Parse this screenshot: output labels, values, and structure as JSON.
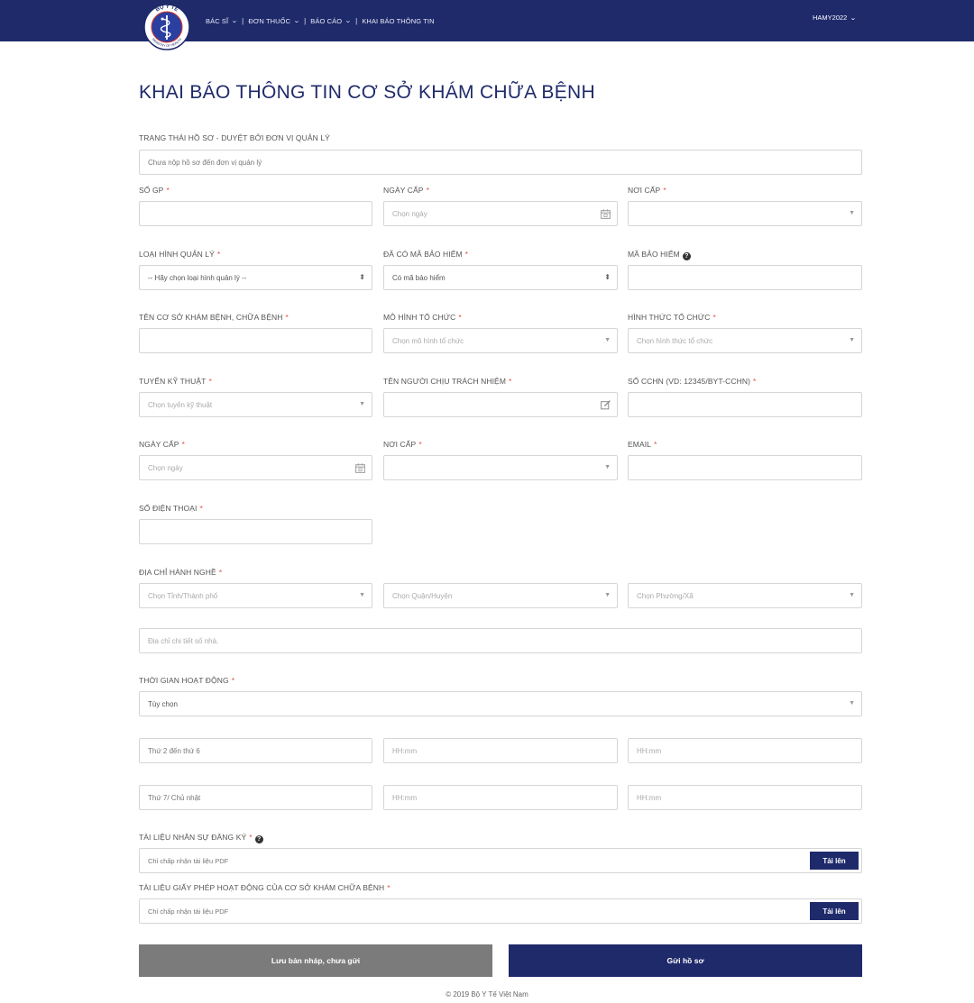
{
  "colors": {
    "brand": "#1f2a6b",
    "draft_button": "#7b7b7b",
    "required": "#e0524f"
  },
  "logo": {
    "top_text": "BỘ Y TẾ",
    "bottom_text": "MINISTRY OF HEALTH"
  },
  "nav": {
    "items": [
      {
        "label": "BÁC SĨ",
        "dropdown": true
      },
      {
        "label": "ĐƠN THUỐC",
        "dropdown": true
      },
      {
        "label": "BÁO CÁO",
        "dropdown": true
      },
      {
        "label": "KHAI BÁO THÔNG TIN",
        "dropdown": false
      }
    ],
    "user": "HAMY2022"
  },
  "page_title": "KHAI BÁO THÔNG TIN CƠ SỞ KHÁM CHỮA BỆNH",
  "form": {
    "status": {
      "label": "TRANG THÁI HỒ SƠ - DUYỆT BỞI ĐƠN VỊ QUẢN LÝ",
      "value": "Chưa nộp hồ sơ đến đơn vị quản lý"
    },
    "so_gp": {
      "label": "SỐ GP",
      "value": ""
    },
    "ngay_cap": {
      "label": "NGÀY CẤP",
      "placeholder": "Chọn ngày"
    },
    "noi_cap": {
      "label": "NƠI CẤP",
      "value": ""
    },
    "loai_hinh": {
      "label": "LOẠI HÌNH QUẢN LÝ",
      "value": "-- Hãy chọn loại hình quản lý --"
    },
    "da_co_ma_bh": {
      "label": "ĐÃ CÓ MÃ BẢO HIỂM",
      "value": "Có mã bảo hiểm"
    },
    "ma_bh": {
      "label": "MÃ BẢO HIỂM",
      "value": ""
    },
    "ten_co_so": {
      "label": "TÊN CƠ SỞ KHÁM BỆNH, CHỮA BỆNH",
      "value": ""
    },
    "mo_hinh": {
      "label": "MÔ HÌNH TỔ CHỨC",
      "placeholder": "Chọn mô hình tổ chức"
    },
    "hinh_thuc": {
      "label": "HÌNH THỨC TỔ CHỨC",
      "placeholder": "Chọn hình thức tổ chức"
    },
    "tuyen_kt": {
      "label": "TUYẾN KỸ THUẬT",
      "placeholder": "Chọn tuyến kỹ thuật"
    },
    "nguoi_chiu_tn": {
      "label": "TÊN NGƯỜI CHỊU TRÁCH NHIỆM",
      "value": ""
    },
    "so_cchn": {
      "label": "SỐ CCHN (VD: 12345/BYT-CCHN)",
      "value": ""
    },
    "ngay_cap2": {
      "label": "NGÀY CẤP",
      "placeholder": "Chọn ngày"
    },
    "noi_cap2": {
      "label": "NƠI CẤP",
      "value": ""
    },
    "email": {
      "label": "EMAIL",
      "value": ""
    },
    "sdt": {
      "label": "SỐ ĐIỆN THOẠI",
      "value": ""
    },
    "dia_chi": {
      "label": "ĐỊA CHỈ HÀNH NGHỀ",
      "tinh_placeholder": "Chọn Tỉnh/Thành phố",
      "quan_placeholder": "Chọn Quận/Huyện",
      "phuong_placeholder": "Chọn Phường/Xã",
      "chi_tiet_placeholder": "Địa chỉ chi tiết số nhà."
    },
    "thoi_gian": {
      "label": "THỜI GIAN HOẠT ĐỘNG",
      "value": "Tùy chọn",
      "rows": [
        {
          "day": "Thứ 2 đến thứ 6",
          "from_placeholder": "HH:mm",
          "to_placeholder": "HH:mm"
        },
        {
          "day": "Thứ 7/ Chủ nhật",
          "from_placeholder": "HH:mm",
          "to_placeholder": "HH:mm"
        }
      ]
    },
    "tai_lieu_ns": {
      "label": "TÀI LIỆU NHÂN SỰ ĐĂNG KÝ",
      "placeholder": "Chỉ chấp nhận tài liệu PDF",
      "button": "Tải lên"
    },
    "tai_lieu_gp": {
      "label": "TÀI LIỆU GIẤY PHÉP HOẠT ĐỘNG CỦA CƠ SỞ KHÁM CHỮA BỆNH",
      "placeholder": "Chỉ chấp nhận tài liệu PDF",
      "button": "Tải lên"
    }
  },
  "buttons": {
    "draft": "Lưu bản nháp, chưa gửi",
    "submit": "Gửi hồ sơ"
  },
  "footer": "© 2019 Bộ Y Tế Việt Nam"
}
